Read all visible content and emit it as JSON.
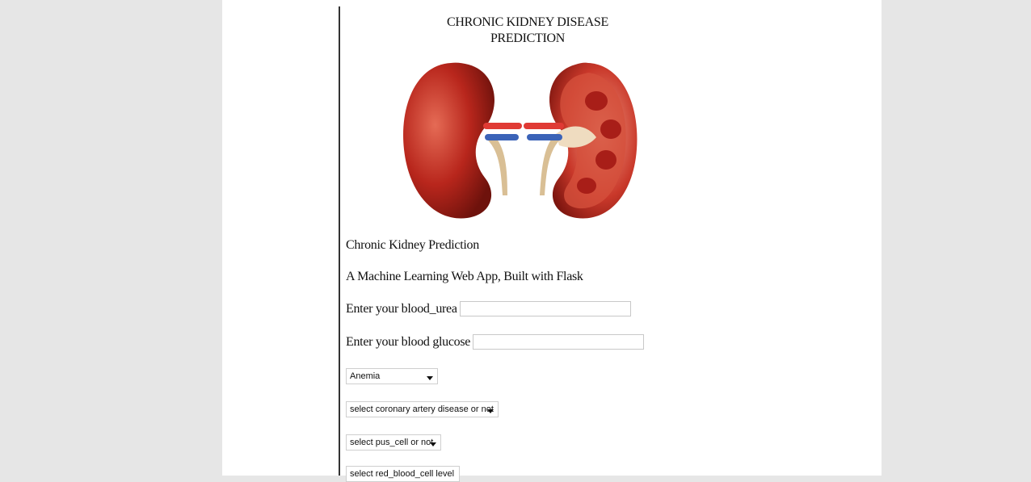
{
  "header": {
    "title_line1": "CHRONIC KIDNEY DISEASE",
    "title_line2": "PREDICTION"
  },
  "intro": {
    "heading": "Chronic Kidney Prediction",
    "subheading": "A Machine Learning Web App, Built with Flask"
  },
  "form": {
    "blood_urea_label": "Enter your blood_urea",
    "blood_urea_value": "",
    "blood_glucose_label": "Enter your blood glucose",
    "blood_glucose_value": "",
    "anemia_select": "Anemia",
    "coronary_select": "select coronary artery disease or not",
    "pus_cell_select": "select pus_cell or not",
    "red_blood_cell_select": "select red_blood_cell level"
  },
  "colors": {
    "page_background": "#e6e6e6",
    "content_background": "#ffffff",
    "kidney_red": "#b8261c",
    "artery_red": "#e03a34",
    "vein_blue": "#3b63b8",
    "ureter_beige": "#d9bf95"
  },
  "icons": {
    "kidney_illustration": "kidney-illustration",
    "dropdown_arrow": "chevron-down-icon"
  }
}
